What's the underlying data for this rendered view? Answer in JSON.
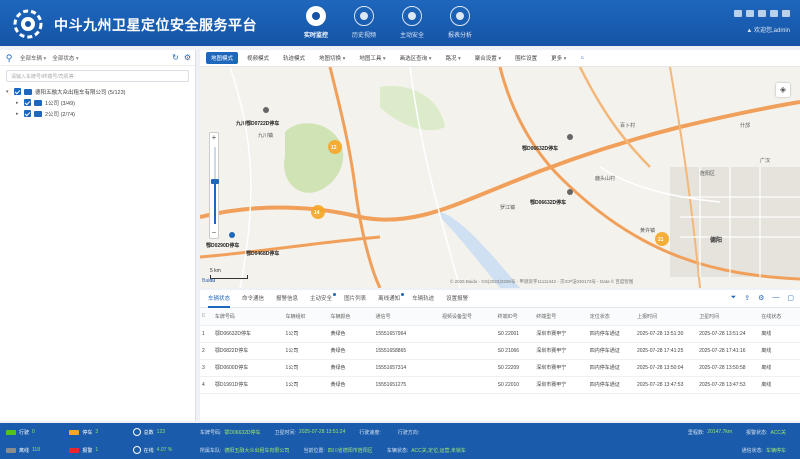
{
  "header": {
    "title": "中斗九州卫星定位安全服务平台",
    "nav": [
      {
        "label": "实时监控",
        "active": true
      },
      {
        "label": "历史视频",
        "active": false
      },
      {
        "label": "主动安全",
        "active": false
      },
      {
        "label": "报表分析",
        "active": false
      }
    ],
    "user_text": "▲ 欢迎您,admin"
  },
  "left": {
    "select_a": "全部车辆",
    "select_b": "全部状态",
    "search_placeholder": "请输入车牌号/终端号/司机等",
    "tree": {
      "root": "德阳五融大众出租车有限公司 (5/123)",
      "children": [
        "1公司 (3/49)",
        "2公司 (2/74)"
      ]
    }
  },
  "map": {
    "toolbar": [
      {
        "label": "地图模式",
        "active": true,
        "dropdown": false
      },
      {
        "label": "视频模式",
        "active": false,
        "dropdown": false
      },
      {
        "label": "轨迹模式",
        "active": false,
        "dropdown": false
      },
      {
        "label": "地图切换",
        "active": false,
        "dropdown": true
      },
      {
        "label": "地图工具",
        "active": false,
        "dropdown": true
      },
      {
        "label": "画选区查询",
        "active": false,
        "dropdown": true
      },
      {
        "label": "路况",
        "active": false,
        "dropdown": true
      },
      {
        "label": "聚合设置",
        "active": false,
        "dropdown": true
      },
      {
        "label": "围栏设置",
        "active": false,
        "dropdown": false
      },
      {
        "label": "更多",
        "active": false,
        "dropdown": true
      }
    ],
    "clusters": [
      "12",
      "14",
      "21"
    ],
    "vehicle_labels": [
      "九川鄂D0722D停车",
      "鄂D06632D停车",
      "鄂D06632D停车",
      "鄂D0290D停车",
      "鄂D0468D停车"
    ],
    "places": [
      "九川镇",
      "百卜村",
      "鹿头山村",
      "罗江镇",
      "旌阳区",
      "黄许镇",
      "德阳",
      "什邡",
      "广汉"
    ],
    "scale": "5 km",
    "copyright": "© 2025 Baidu - GS(2023)3206号 - 甲测资字11111342 - 京ICP证030173号 - Data © 百度智图"
  },
  "table": {
    "tabs": [
      {
        "label": "车辆状态",
        "active": true,
        "badge": false
      },
      {
        "label": "命令通信",
        "active": false,
        "badge": false
      },
      {
        "label": "报警信息",
        "active": false,
        "badge": false
      },
      {
        "label": "主动安全",
        "active": false,
        "badge": true
      },
      {
        "label": "图片列表",
        "active": false,
        "badge": false
      },
      {
        "label": "离线通知",
        "active": false,
        "badge": true
      },
      {
        "label": "车辆轨迹",
        "active": false,
        "badge": false
      },
      {
        "label": "设置报警",
        "active": false,
        "badge": false
      }
    ],
    "columns": [
      "车牌号码",
      "车辆组织",
      "车辆颜色",
      "通信号",
      "视频设备型号",
      "终端ID号",
      "终端型号",
      "定位状态",
      "上报时间",
      "卫星时间",
      "在线状态"
    ],
    "rows": [
      [
        "鄂D06632D停车",
        "1公司",
        "黄绿色",
        "15551657964",
        "",
        "S0 22001",
        "深圳市赛甲宁",
        "四内停车通证",
        "2025-07-28 13:51:30",
        "2025-07-28 13:51:24",
        "离线"
      ],
      [
        "鄂D0822D停车",
        "1公司",
        "黄绿色",
        "15551658865",
        "",
        "S0 21066",
        "深圳市赛甲宁",
        "四内停车通证",
        "2025-07-28 17:41:25",
        "2025-07-28 17:41:16",
        "离线"
      ],
      [
        "鄂D0600D停车",
        "1公司",
        "黄绿色",
        "15551657314",
        "",
        "S0 22209",
        "深圳市赛甲宁",
        "四内停车通证",
        "2025-07-28 13:50:04",
        "2025-07-28 13:50:58",
        "离线"
      ],
      [
        "鄂D1991D停车",
        "1公司",
        "黄绿色",
        "15551651275",
        "",
        "S0 22010",
        "深圳市赛甲宁",
        "四内停车通证",
        "2025-07-28 13:47:53",
        "2025-07-28 13:47:53",
        "离线"
      ]
    ]
  },
  "status": {
    "stats": [
      {
        "label": "行驶",
        "value": "0",
        "color": "#52c41a",
        "kind": "car"
      },
      {
        "label": "停车",
        "value": "3",
        "color": "#f5a623",
        "kind": "car"
      },
      {
        "label": "总数",
        "value": "123",
        "color": "#ffffff",
        "kind": "circle"
      },
      {
        "label": "离线",
        "value": "118",
        "color": "#8c8c8c",
        "kind": "car"
      },
      {
        "label": "报警",
        "value": "1",
        "color": "#f5222d",
        "kind": "car"
      },
      {
        "label": "在线",
        "value": "4.07 %",
        "color": "#ffffff",
        "kind": "circle"
      }
    ],
    "info_row1": [
      {
        "k": "车牌号码:",
        "v": "鄂D06632D停车"
      },
      {
        "k": "卫星时间:",
        "v": "2025-07-28 13:51:24"
      },
      {
        "k": "行驶速度:",
        "v": ""
      },
      {
        "k": "行驶方向:",
        "v": ""
      },
      {
        "k": "里程数:",
        "v": "20147.7km"
      },
      {
        "k": "报警状态:",
        "v": "ACC关"
      }
    ],
    "info_row2": [
      {
        "k": "所属车队:",
        "v": "德阳五融大众出租车有限公司"
      },
      {
        "k": "当前位置:",
        "v": "四川省德阳市旌阳区"
      },
      {
        "k": "车辆状态:",
        "v": "ACC关,定位,运营,未锁车"
      },
      {
        "k": "通信状态:",
        "v": "车辆停车"
      }
    ]
  },
  "colors": {
    "brand_blue": "#1e67bd",
    "header_bg": "#1554a6",
    "status_bg": "#1a5cab",
    "highlight_green": "#9fe86d",
    "cluster_orange": "#f5a623"
  }
}
